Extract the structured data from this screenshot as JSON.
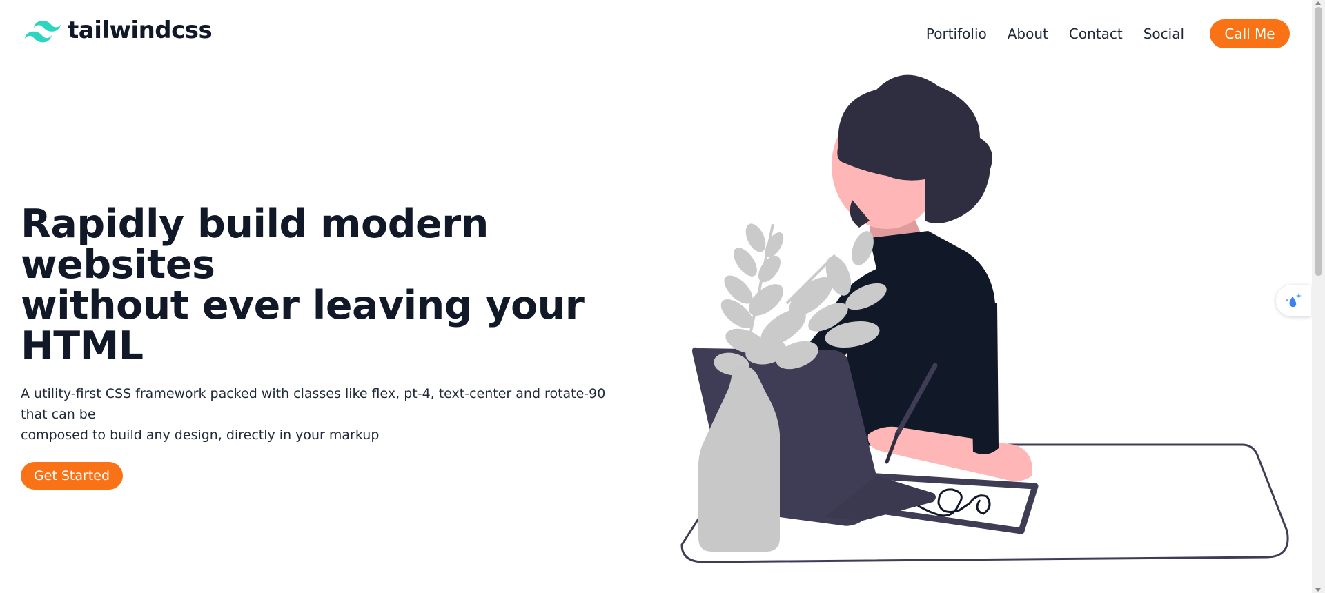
{
  "header": {
    "logo_text": "tailwindcss",
    "nav": [
      "Portifolio",
      "About",
      "Contact",
      "Social"
    ],
    "cta_label": "Call Me"
  },
  "hero": {
    "title_lines": [
      "Rapidly build modern websites",
      "without ever leaving your",
      "HTML"
    ],
    "subtitle_lines": [
      "A utility-first CSS framework packed with classes like flex, pt-4, text-center and rotate-90 that can be",
      "composed to build any design, directly in your markup"
    ],
    "cta_label": "Get Started"
  },
  "illustration": {
    "name": "woman-working-at-desk-illustration",
    "colors": {
      "dark": "#2f2e41",
      "shirt": "#111827",
      "skin": "#ffb6b6",
      "plant": "#cacaca",
      "laptop": "#3f3d56"
    }
  },
  "icons": {
    "logo": "tailwind-wave-icon",
    "widget": "water-drop-sparkle-icon"
  },
  "colors": {
    "accent": "#f97316",
    "logo": "#38bdf8",
    "text": "#111827"
  }
}
